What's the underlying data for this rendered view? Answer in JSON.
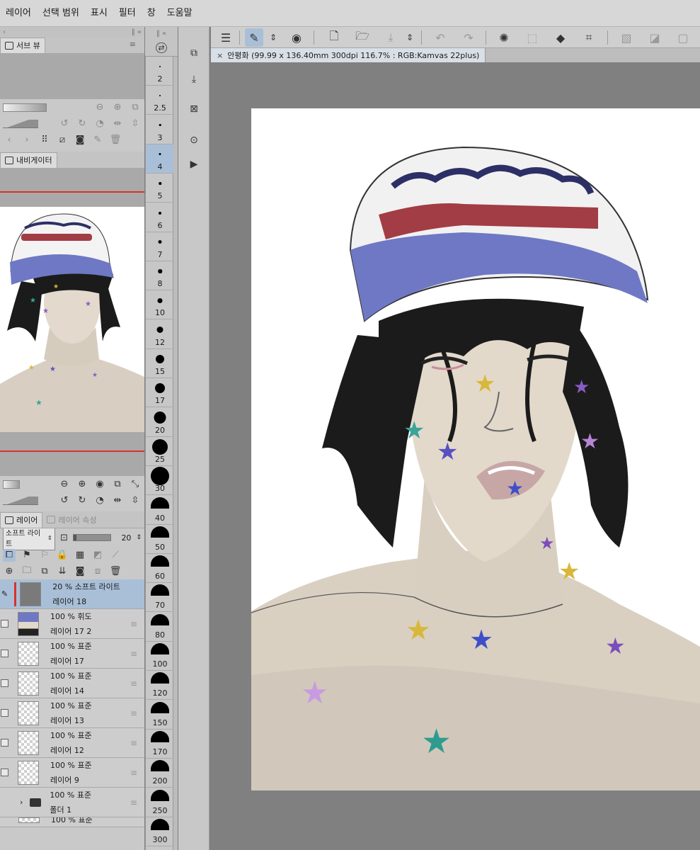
{
  "menubar": {
    "items": [
      "레이어",
      "선택 범위",
      "표시",
      "필터",
      "창",
      "도움말"
    ]
  },
  "sub_view": {
    "tab_label": "서브 뷰"
  },
  "navigator": {
    "tab_label": "내비게이터"
  },
  "layer_panel": {
    "tabs": [
      "레이어",
      "레이어 속성"
    ],
    "blend_mode": "소프트 라이트",
    "opacity_value": "20",
    "layers": [
      {
        "opacity_mode": "20 % 소프트 라이트",
        "name": "레이어 18",
        "selected": true,
        "thumb": "solid"
      },
      {
        "opacity_mode": "100 % 휘도",
        "name": "레이어 17 2",
        "selected": false,
        "thumb": "image"
      },
      {
        "opacity_mode": "100 % 표준",
        "name": "레이어 17",
        "selected": false,
        "thumb": "checker"
      },
      {
        "opacity_mode": "100 % 표준",
        "name": "레이어 14",
        "selected": false,
        "thumb": "checker"
      },
      {
        "opacity_mode": "100 % 표준",
        "name": "레이어 13",
        "selected": false,
        "thumb": "checker"
      },
      {
        "opacity_mode": "100 % 표준",
        "name": "레이어 12",
        "selected": false,
        "thumb": "checker"
      },
      {
        "opacity_mode": "100 % 표준",
        "name": "레이어 9",
        "selected": false,
        "thumb": "checker"
      }
    ],
    "folder": {
      "opacity_mode": "100 % 표준",
      "name": "폴더 1"
    },
    "partial_row": "100 % 표준"
  },
  "brush_sizes": [
    "2",
    "2.5",
    "3",
    "4",
    "5",
    "6",
    "7",
    "8",
    "10",
    "12",
    "15",
    "17",
    "20",
    "25",
    "30",
    "40",
    "50",
    "60",
    "70",
    "80",
    "100",
    "120",
    "150",
    "170",
    "200",
    "250",
    "300"
  ],
  "selected_brush_size": "4",
  "document": {
    "tab_title": "안평화 (99.99 x 136.40mm 300dpi 116.7% : RGB:Kamvas 22plus)"
  },
  "colors": {
    "selection_blue": "#a9bfd7",
    "accent_red": "#d8322b",
    "panel_gray": "#c9c9c9",
    "canvas_bg": "#808080",
    "cap_blue": "#6f78c4",
    "cap_red": "#a23c45",
    "skin": "#ded5c8",
    "hair": "#1b1b1b"
  },
  "icons": {
    "toolbar": [
      "hamburger-icon",
      "pen-settings-icon",
      "double-chevron-icon",
      "clip-studio-icon",
      "new-canvas-icon",
      "open-folder-icon",
      "save-icon",
      "undo-icon",
      "redo-icon",
      "loading-spinner-icon",
      "selection-icon",
      "fill-icon",
      "transform-icon",
      "hatch-icon",
      "gradient-icon",
      "frame-icon"
    ]
  }
}
